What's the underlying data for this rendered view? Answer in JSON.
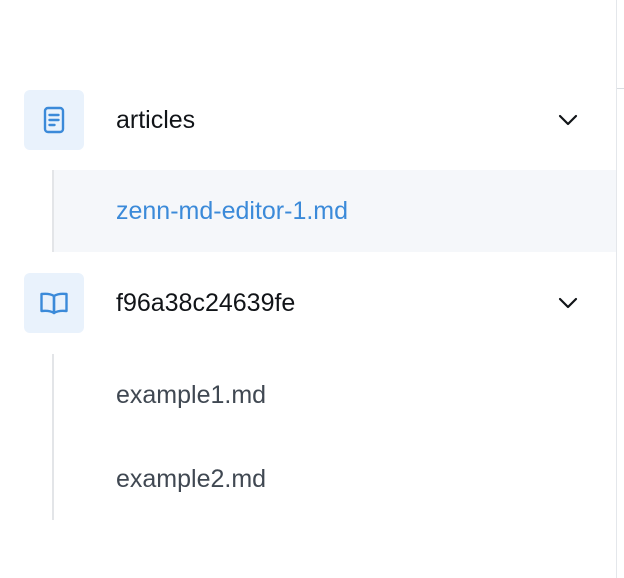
{
  "colors": {
    "accent": "#3b8ad9",
    "icon_bg": "#e9f2fc",
    "active_bg": "#f5f7fa",
    "title": "#111418",
    "file_text": "#404852",
    "tree_line": "#e3e5e8"
  },
  "groups": [
    {
      "title": "articles",
      "icon": "document-icon",
      "expanded": true,
      "items": [
        {
          "label": "zenn-md-editor-1.md",
          "active": true
        }
      ]
    },
    {
      "title": "f96a38c24639fe",
      "icon": "book-icon",
      "expanded": true,
      "items": [
        {
          "label": "example1.md",
          "active": false
        },
        {
          "label": "example2.md",
          "active": false
        }
      ]
    }
  ]
}
